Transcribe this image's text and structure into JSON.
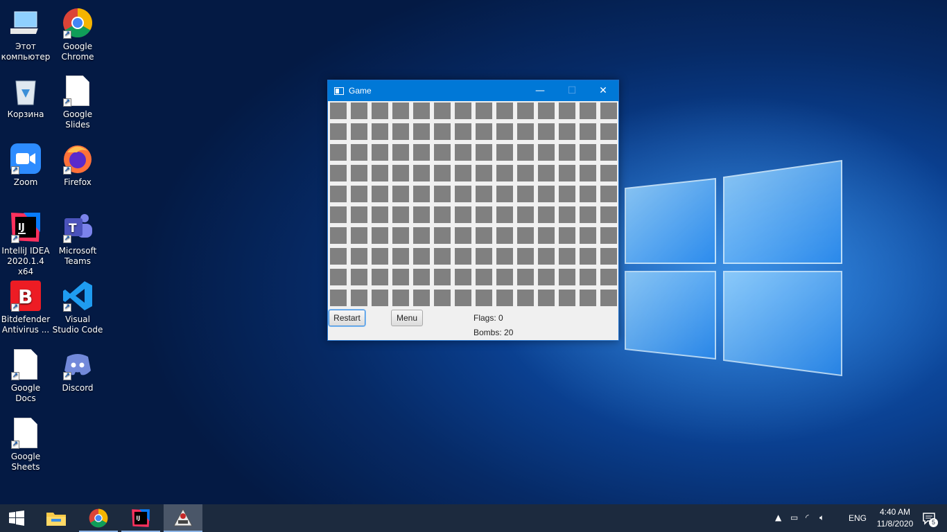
{
  "desktop": {
    "icons": [
      {
        "label": "Этот компьютер",
        "icon": "computer-icon"
      },
      {
        "label": "Google Chrome",
        "icon": "chrome-icon"
      },
      {
        "label": "Корзина",
        "icon": "recycle-bin-icon"
      },
      {
        "label": "Google Slides",
        "icon": "document-icon"
      },
      {
        "label": "Zoom",
        "icon": "zoom-icon"
      },
      {
        "label": "Firefox",
        "icon": "firefox-icon"
      },
      {
        "label": "IntelliJ IDEA 2020.1.4 x64",
        "icon": "intellij-icon"
      },
      {
        "label": "Microsoft Teams",
        "icon": "teams-icon"
      },
      {
        "label": "Bitdefender Antivirus ...",
        "icon": "bitdefender-icon"
      },
      {
        "label": "Visual Studio Code",
        "icon": "vscode-icon"
      },
      {
        "label": "Google Docs",
        "icon": "document-icon"
      },
      {
        "label": "Discord",
        "icon": "discord-icon"
      },
      {
        "label": "Google Sheets",
        "icon": "document-icon"
      }
    ]
  },
  "window": {
    "title": "Game",
    "controls": {
      "minimize": "—",
      "maximize": "☐",
      "close": "✕"
    },
    "board": {
      "rows": 10,
      "columns": 14,
      "cell_color": "#808080"
    },
    "buttons": {
      "restart": "Restart",
      "menu": "Menu"
    },
    "flags_label": "Flags: 0",
    "bombs_label": "Bombs: 20"
  },
  "taskbar": {
    "language": "ENG",
    "time": "4:40 AM",
    "date": "11/8/2020",
    "notification_count": "5"
  },
  "colors": {
    "titlebar": "#0078d7",
    "taskbar": "#1c2a3e",
    "cell": "#808080"
  }
}
